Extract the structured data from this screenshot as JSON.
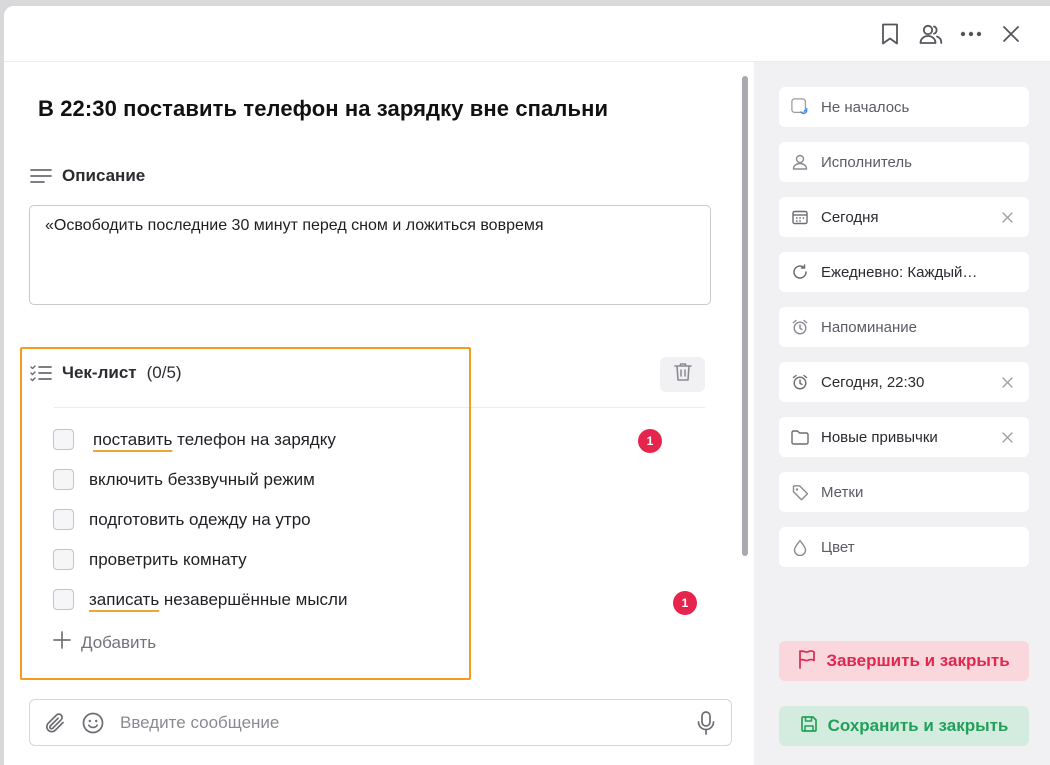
{
  "task": {
    "title": "В 22:30 поставить телефон на зарядку вне спальни",
    "description_label": "Описание",
    "description_text": "«Освободить последние 30 минут перед сном и ложиться вовремя"
  },
  "checklist": {
    "label": "Чек-лист",
    "count": "(0/5)",
    "items": [
      {
        "underlined": "поставить",
        "rest": " телефон на зарядку",
        "badge": "1"
      },
      {
        "text": "включить беззвучный режим"
      },
      {
        "text": "подготовить одежду на утро"
      },
      {
        "text": "проветрить комнату"
      },
      {
        "underlined": "записать",
        "rest": " незавершённые мысли",
        "badge": "1"
      }
    ],
    "add_label": "Добавить"
  },
  "composer": {
    "placeholder": "Введите сообщение"
  },
  "sidebar": {
    "status": "Не началось",
    "assignee": "Исполнитель",
    "date": "Сегодня",
    "repeat": "Ежедневно: Каждый…",
    "reminder_placeholder": "Напоминание",
    "reminder_value": "Сегодня, 22:30",
    "folder": "Новые привычки",
    "tags": "Метки",
    "color": "Цвет",
    "finish_button": "Завершить и закрыть",
    "save_button": "Сохранить и закрыть"
  },
  "icons": {
    "topbar": [
      "bookmark-icon",
      "users-icon",
      "more-icon",
      "close-icon"
    ]
  },
  "colors": {
    "accent_red": "#e0284f",
    "accent_green": "#22a05a",
    "highlight_orange": "#f39c21",
    "badge_red": "#e6254e"
  }
}
